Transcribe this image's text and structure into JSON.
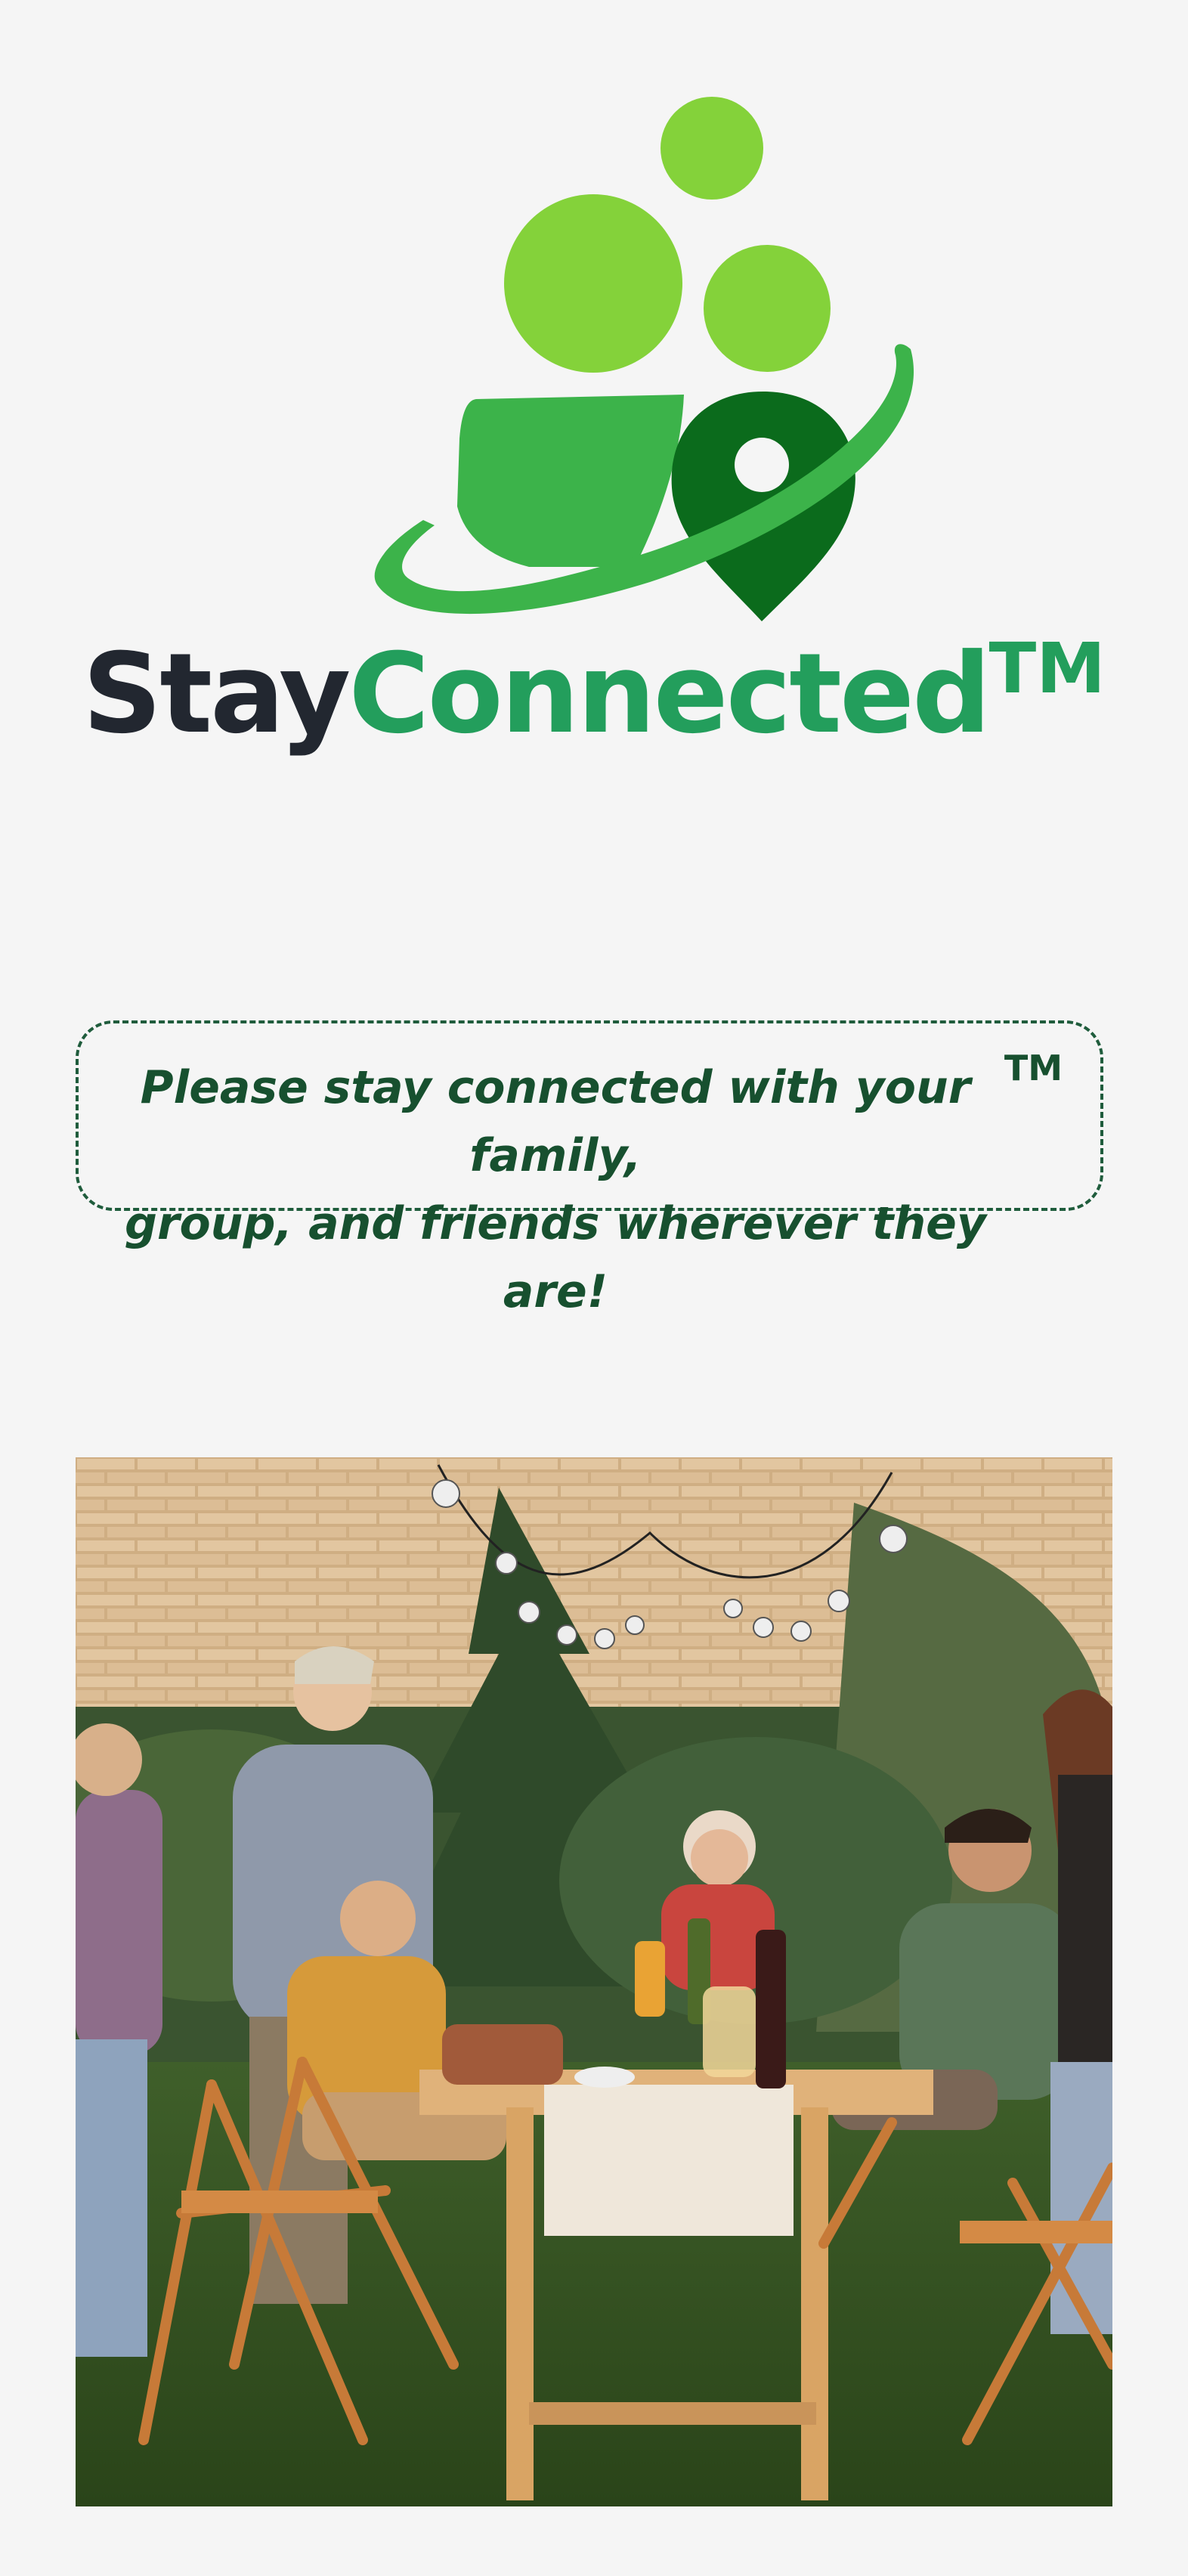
{
  "brand": {
    "stay": "Stay",
    "connected": "Connected",
    "trademark": "TM"
  },
  "logo": {
    "icon": "people-location-orbit-icon",
    "colors": {
      "light_green": "#84d23a",
      "mid_green": "#3cb34a",
      "dark_green": "#0b6b1c"
    }
  },
  "tagline": {
    "line1": "Please stay connected with your family,",
    "line2": "group, and friends wherever they are!",
    "trademark": "TM"
  },
  "photo": {
    "description_icon": "family-dinner-photo"
  },
  "colors": {
    "background": "#f5f5f5",
    "brand_dark": "#222730",
    "brand_green": "#239e5c",
    "tagline_green": "#17502f"
  }
}
